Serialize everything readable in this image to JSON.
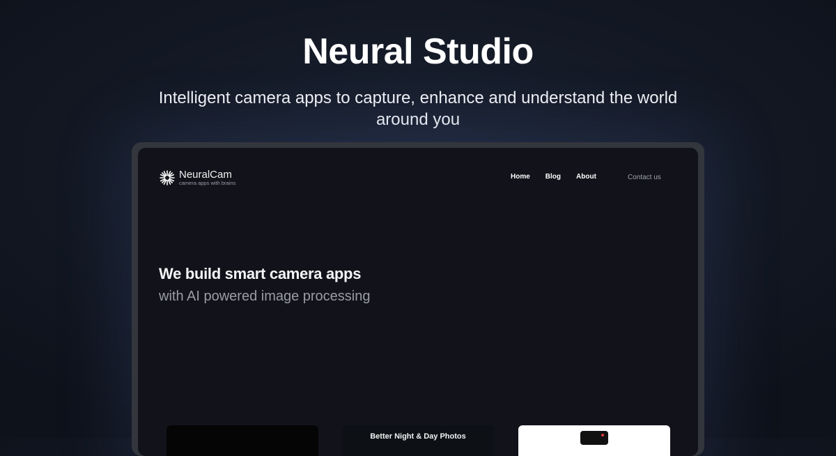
{
  "hero": {
    "title": "Neural Studio",
    "subtitle": "Intelligent camera apps to capture, enhance and understand the world around you"
  },
  "preview": {
    "logo": {
      "icon": "starburst-icon",
      "name": "NeuralCam",
      "tagline": "camera apps with brains"
    },
    "nav": {
      "links": [
        "Home",
        "Blog",
        "About"
      ],
      "contact": "Contact us"
    },
    "headline": "We build smart camera apps",
    "subheadline": "with AI powered image processing",
    "cards": [
      {
        "title": ""
      },
      {
        "title": "Better Night & Day Photos"
      },
      {
        "title": ""
      }
    ]
  },
  "colors": {
    "background": "#141a26",
    "frame": "#34363d",
    "screen": "#12131a",
    "muted_text": "#9a9ca6",
    "card_light": "#ffffff"
  }
}
